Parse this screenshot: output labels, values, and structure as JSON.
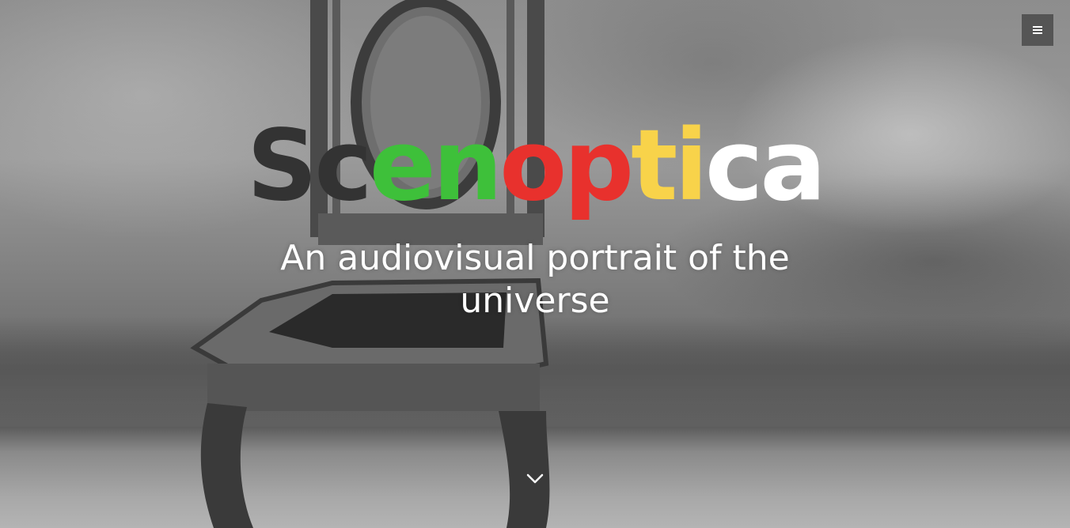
{
  "hero": {
    "title_letters": [
      {
        "char": "S",
        "color": "#333333"
      },
      {
        "char": "c",
        "color": "#333333"
      },
      {
        "char": "e",
        "color": "#3ec03a"
      },
      {
        "char": "n",
        "color": "#3ec03a"
      },
      {
        "char": "o",
        "color": "#e8312d"
      },
      {
        "char": "p",
        "color": "#e8312d"
      },
      {
        "char": "t",
        "color": "#f8d34a"
      },
      {
        "char": "i",
        "color": "#f8d34a"
      },
      {
        "char": "c",
        "color": "#ffffff"
      },
      {
        "char": "a",
        "color": "#ffffff"
      }
    ],
    "subtitle": "An audiovisual portrait of the universe"
  },
  "nav": {
    "menu_icon": "hamburger-icon"
  },
  "scroll": {
    "icon": "chevron-down-icon"
  },
  "colors": {
    "dark": "#333333",
    "green": "#3ec03a",
    "red": "#e8312d",
    "yellow": "#f8d34a",
    "white": "#ffffff"
  }
}
